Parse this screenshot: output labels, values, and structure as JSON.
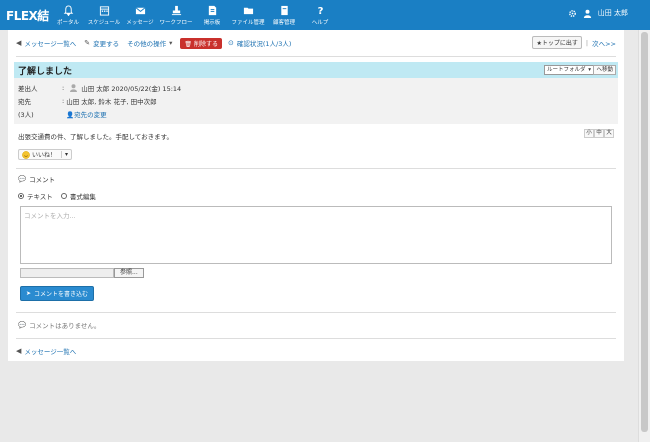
{
  "app": {
    "logo": "FLEX結"
  },
  "nav": [
    {
      "label": "ポータル",
      "icon": "bell-icon"
    },
    {
      "label": "スケジュール",
      "icon": "calendar-icon"
    },
    {
      "label": "メッセージ",
      "icon": "mail-icon"
    },
    {
      "label": "ワークフロー",
      "icon": "stamp-icon"
    },
    {
      "label": "掲示板",
      "icon": "board-icon"
    },
    {
      "label": "ファイル管理",
      "icon": "folder-icon"
    },
    {
      "label": "顧客管理",
      "icon": "book-icon"
    },
    {
      "label": "ヘルプ",
      "icon": "question-icon"
    }
  ],
  "user": {
    "name": "山田 太郎"
  },
  "toolbar": {
    "back": "メッセージ一覧へ",
    "edit": "変更する",
    "other": "その他の操作",
    "delete": "削除する",
    "confirm": "確認状況(1人/3人)",
    "to_top": "トップに出す",
    "next": "次へ>>"
  },
  "message": {
    "title": "了解しました",
    "folder": "ルートフォルダ",
    "move": "へ移動",
    "sender_label": "差出人",
    "sender": "山田 太郎 2020/05/22(金) 15:14",
    "to_label": "宛先",
    "to": "山田 太郎, 鈴木 花子, 田中次郎",
    "count_label": "(3人)",
    "change_recipients": "宛先の変更",
    "body": "出張交通費の件、了解しました。手配しておきます。",
    "sizes": [
      "小",
      "中",
      "大"
    ],
    "like": "いいね！"
  },
  "comment": {
    "heading": "コメント",
    "mode_text": "テキスト",
    "mode_rich": "書式編集",
    "placeholder": "コメントを入力...",
    "browse": "参照...",
    "submit": "コメントを書き込む",
    "none": "コメントはありません。"
  },
  "footer": {
    "back": "メッセージ一覧へ"
  },
  "colors": {
    "header": "#1a7fc4",
    "title_bg": "#bfe9f3",
    "delete": "#c9302c",
    "accent": "#2a8bd0"
  }
}
